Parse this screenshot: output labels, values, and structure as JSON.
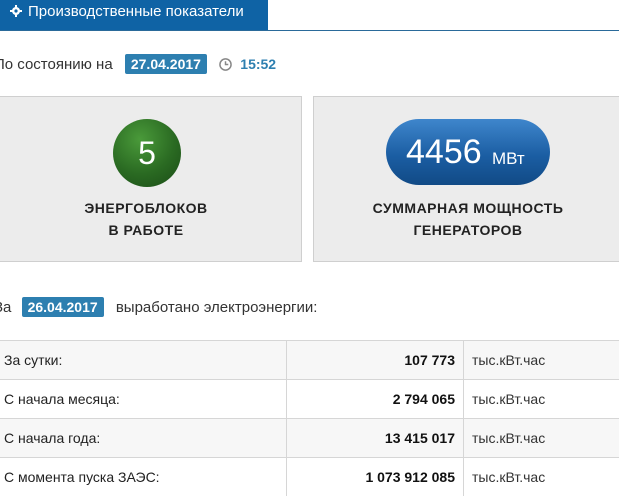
{
  "tab": {
    "label": "Производственные показатели",
    "icon": "gear-icon"
  },
  "status": {
    "label": "По состоянию на",
    "date": "27.04.2017",
    "time": "15:52",
    "time_icon": "clock-icon"
  },
  "cards": {
    "units": {
      "value": "5",
      "line1": "ЭНЕРГОБЛОКОВ",
      "line2": "В РАБОТЕ",
      "color": "#2a6a22"
    },
    "power": {
      "value": "4456",
      "unit": "МВт",
      "line1": "СУММАРНАЯ МОЩНОСТЬ",
      "line2": "ГЕНЕРАТОРОВ",
      "color": "#1b5ea3"
    }
  },
  "produced": {
    "prefix": "За",
    "date": "26.04.2017",
    "suffix": "выработано электроэнергии:"
  },
  "table": {
    "rows": [
      {
        "label": "За сутки:",
        "value": "107 773",
        "unit": "тыс.кВт.час"
      },
      {
        "label": "С начала месяца:",
        "value": "2 794 065",
        "unit": "тыс.кВт.час"
      },
      {
        "label": "С начала года:",
        "value": "13 415 017",
        "unit": "тыс.кВт.час"
      },
      {
        "label": "С момента пуска ЗАЭС:",
        "value": "1 073 912 085",
        "unit": "тыс.кВт.час"
      }
    ]
  },
  "colors": {
    "tab_bg": "#0f63a5",
    "badge_bg": "#2d7fb0"
  }
}
